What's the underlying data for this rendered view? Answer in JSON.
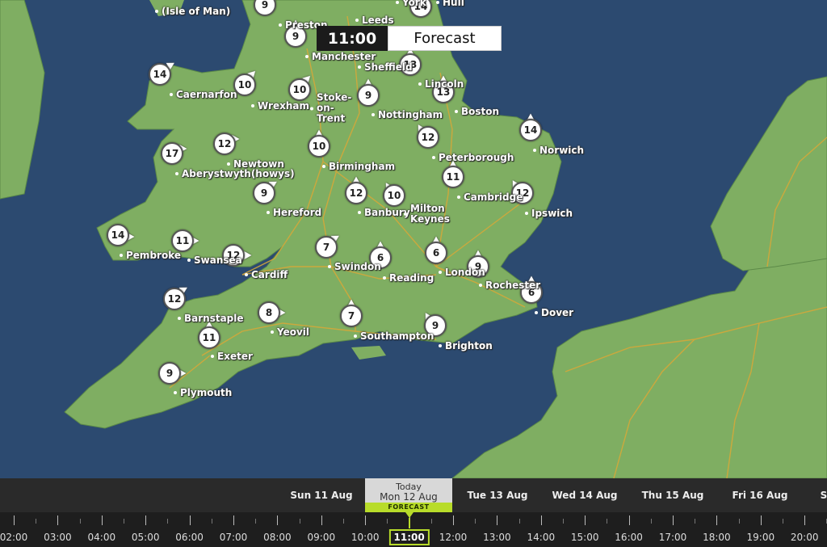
{
  "overlay": {
    "time": "11:00",
    "mode": "Forecast"
  },
  "colors": {
    "sea": "#2c4a70",
    "land": "#7fae62",
    "accent": "#b8dc2a"
  },
  "cities": [
    {
      "name": "Leeds"
    },
    {
      "name": "Preston"
    },
    {
      "name": "Manchester"
    },
    {
      "name": "Sheffield"
    },
    {
      "name": "Lincoln"
    },
    {
      "name": "Caernarfon"
    },
    {
      "name": "Wrexham"
    },
    {
      "name": "Stoke-on-Trent"
    },
    {
      "name": "Nottingham"
    },
    {
      "name": "Boston"
    },
    {
      "name": "Norwich"
    },
    {
      "name": "Newtown"
    },
    {
      "name": "Aberystwyth"
    },
    {
      "name": "Birmingham"
    },
    {
      "name": "Peterborough"
    },
    {
      "name": "Cambridge"
    },
    {
      "name": "Hereford"
    },
    {
      "name": "Banbury"
    },
    {
      "name": "Milton Keynes"
    },
    {
      "name": "Ipswich"
    },
    {
      "name": "Pembroke"
    },
    {
      "name": "Swansea"
    },
    {
      "name": "Cardiff"
    },
    {
      "name": "Swindon"
    },
    {
      "name": "Reading"
    },
    {
      "name": "London"
    },
    {
      "name": "Rochester"
    },
    {
      "name": "Dover"
    },
    {
      "name": "Barnstaple"
    },
    {
      "name": "Yeovil"
    },
    {
      "name": "Southampton"
    },
    {
      "name": "Brighton"
    },
    {
      "name": "Exeter"
    },
    {
      "name": "Plymouth"
    },
    {
      "name": "Hull"
    },
    {
      "name": "York"
    },
    {
      "name": "(Isle of Man)"
    }
  ],
  "temperatures": [
    "9",
    "14",
    "9",
    "13",
    "10",
    "14",
    "10",
    "9",
    "13",
    "12",
    "17",
    "10",
    "14",
    "12",
    "11",
    "12",
    "9",
    "12",
    "10",
    "14",
    "11",
    "12",
    "7",
    "6",
    "6",
    "9",
    "12",
    "6",
    "8",
    "7",
    "9",
    "11",
    "9"
  ],
  "timeline": {
    "days": [
      "Sun 11 Aug",
      "Tue 13 Aug",
      "Wed 14 Aug",
      "Thu 15 Aug",
      "Fri 16 Aug",
      "S"
    ],
    "today": {
      "line1": "Today",
      "line2": "Mon 12 Aug",
      "badge": "FORECAST"
    },
    "hours": [
      "02:00",
      "03:00",
      "04:00",
      "05:00",
      "06:00",
      "07:00",
      "08:00",
      "09:00",
      "10:00",
      "11:00",
      "12:00",
      "13:00",
      "14:00",
      "15:00",
      "16:00",
      "17:00",
      "18:00",
      "19:00",
      "20:00"
    ],
    "current_hour": "11:00"
  }
}
